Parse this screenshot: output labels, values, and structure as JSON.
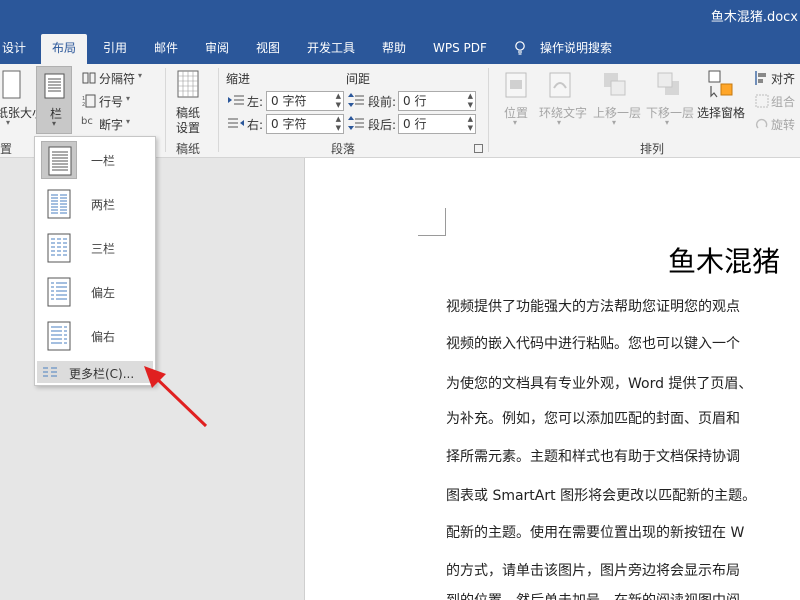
{
  "window": {
    "title": "鱼木混猪.docx"
  },
  "tabs": [
    {
      "label": "设计"
    },
    {
      "label": "布局"
    },
    {
      "label": "引用"
    },
    {
      "label": "邮件"
    },
    {
      "label": "审阅"
    },
    {
      "label": "视图"
    },
    {
      "label": "开发工具"
    },
    {
      "label": "帮助"
    },
    {
      "label": "WPS PDF"
    },
    {
      "label": "操作说明搜索"
    }
  ],
  "ribbon": {
    "page_setup": {
      "size_label": "纸张大小",
      "columns_label": "栏",
      "breaks_label": "分隔符",
      "line_numbers_label": "行号",
      "hyphenation_label": "断字",
      "group_label": "置"
    },
    "draft": {
      "label_line1": "稿纸",
      "label_line2": "设置",
      "group_label": "稿纸"
    },
    "paragraph": {
      "indent_header": "缩进",
      "spacing_header": "间距",
      "left_label": "左:",
      "right_label": "右:",
      "before_label": "段前:",
      "after_label": "段后:",
      "left_value": "0 字符",
      "right_value": "0 字符",
      "before_value": "0 行",
      "after_value": "0 行",
      "group_label": "段落"
    },
    "arrange": {
      "position": "位置",
      "wrap_text": "环绕文字",
      "bring_forward": "上移一层",
      "send_backward": "下移一层",
      "selection_pane": "选择窗格",
      "align": "对齐",
      "group": "组合",
      "rotate": "旋转",
      "group_label": "排列"
    }
  },
  "columns_menu": {
    "items": [
      {
        "label": "一栏"
      },
      {
        "label": "两栏"
      },
      {
        "label": "三栏"
      },
      {
        "label": "偏左"
      },
      {
        "label": "偏右"
      }
    ],
    "more_label": "更多栏(C)..."
  },
  "document": {
    "title": "鱼木混猪",
    "lines": [
      "视频提供了功能强大的方法帮助您证明您的观点",
      "视频的嵌入代码中进行粘贴。您也可以键入一个",
      "为使您的文档具有专业外观，Word 提供了页眉、",
      "为补充。例如，您可以添加匹配的封面、页眉和",
      "择所需元素。主题和样式也有助于文档保持协调",
      "图表或 SmartArt 图形将会更改以匹配新的主题。",
      "配新的主题。使用在需要位置出现的新按钮在 W",
      "的方式，请单击该图片，图片旁边将会显示布局",
      "到的位置，然后单击加号。在新的阅读视图中阅"
    ]
  }
}
